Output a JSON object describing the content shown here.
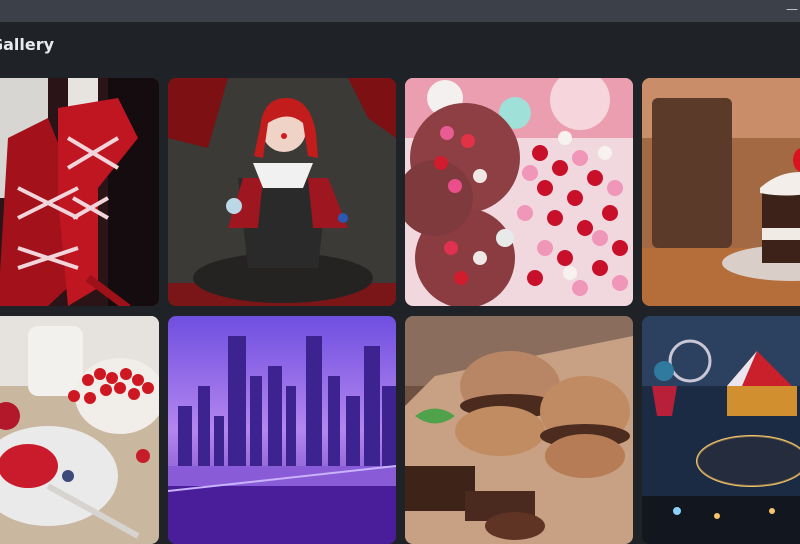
{
  "window": {
    "title_bar_button": "—"
  },
  "header": {
    "title": "Gallery"
  },
  "gallery": {
    "items": [
      {
        "name": "boots"
      },
      {
        "name": "clown-girl"
      },
      {
        "name": "cookies"
      },
      {
        "name": "cake"
      },
      {
        "name": "berries"
      },
      {
        "name": "purple-city"
      },
      {
        "name": "macarons"
      },
      {
        "name": "circus"
      }
    ]
  }
}
